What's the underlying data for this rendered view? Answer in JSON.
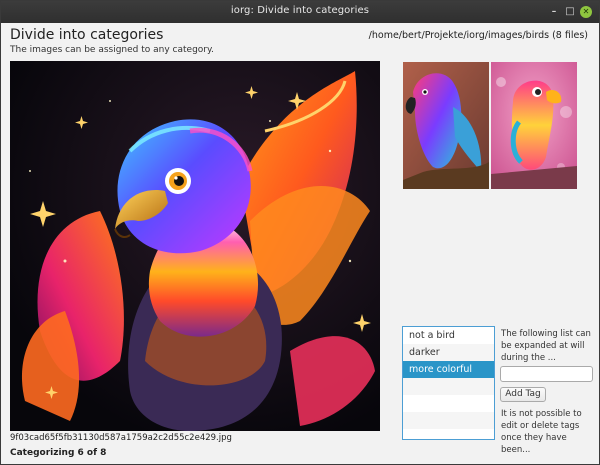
{
  "window": {
    "title": "iorg: Divide into categories"
  },
  "header": {
    "heading": "Divide into categories",
    "subheading": "The images can be assigned to any category.",
    "path": "/home/bert/Projekte/iorg/images/birds (8 files)"
  },
  "main_image": {
    "filename": "9f03cad65f5fb31130d587a1759a2c2d55c2e429.jpg"
  },
  "status": "Categorizing 6 of 8",
  "tags": {
    "items": [
      "not a bird",
      "darker",
      "more colorful"
    ],
    "selected": "more colorful"
  },
  "sidebar": {
    "info_text": "The following list can be expanded at will during the ...",
    "input_placeholder": "",
    "add_button": "Add Tag",
    "note_text": "It is not possible to edit or delete tags once they have been..."
  },
  "colors": {
    "selection": "#2a95c8",
    "list_border": "#4c9ed4",
    "close_button": "#8fc63f"
  }
}
